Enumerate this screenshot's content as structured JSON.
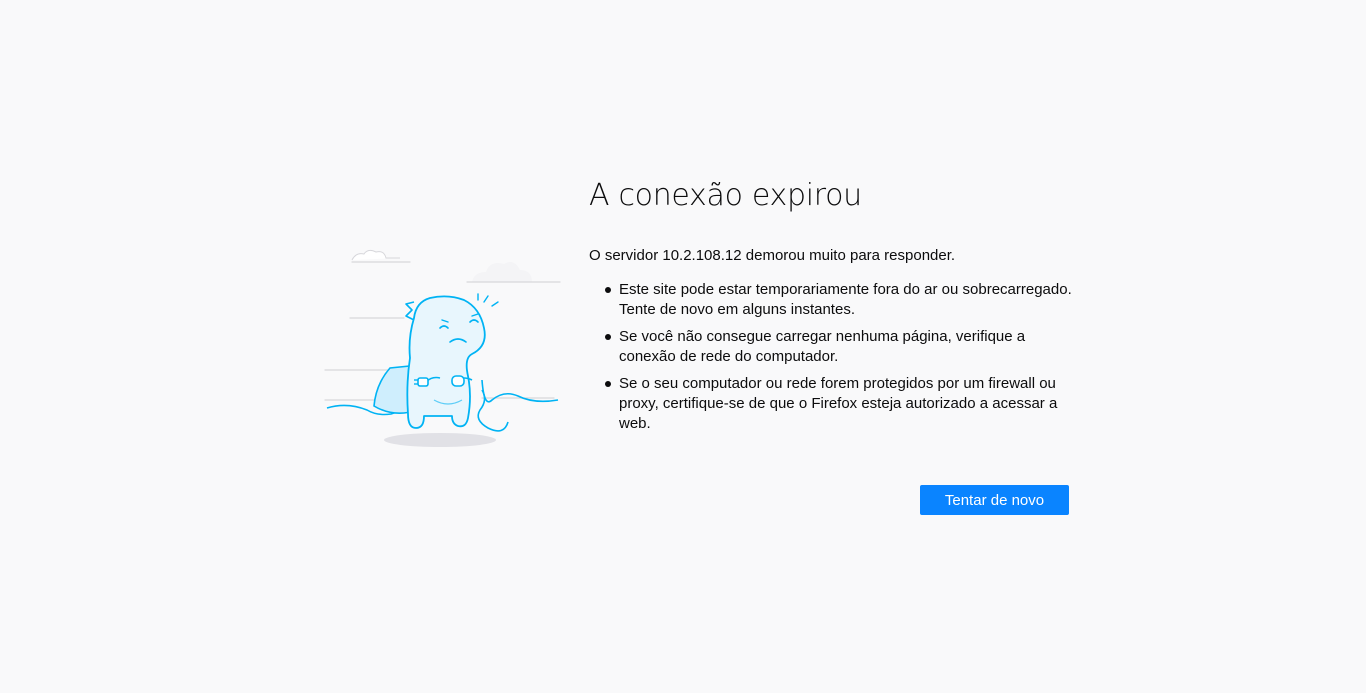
{
  "error": {
    "title": "A conexão expirou",
    "description": "O servidor 10.2.108.12 demorou muito para responder.",
    "bullets": [
      "Este site pode estar temporariamente fora do ar ou sobrecarregado. Tente de novo em alguns instantes.",
      "Se você não consegue carregar nenhuma página, verifique a conexão de rede do computador.",
      "Se o seu computador ou rede forem protegidos por um firewall ou proxy, certifique-se de que o Firefox esteja autorizado a acessar a web."
    ],
    "retry_label": "Tentar de novo",
    "illustration_icon": "disconnected-dino-icon"
  },
  "colors": {
    "background": "#f9f9fa",
    "accent": "#0a84ff",
    "illustration_stroke": "#00b3f4",
    "illustration_fill": "#e8f6fd"
  }
}
